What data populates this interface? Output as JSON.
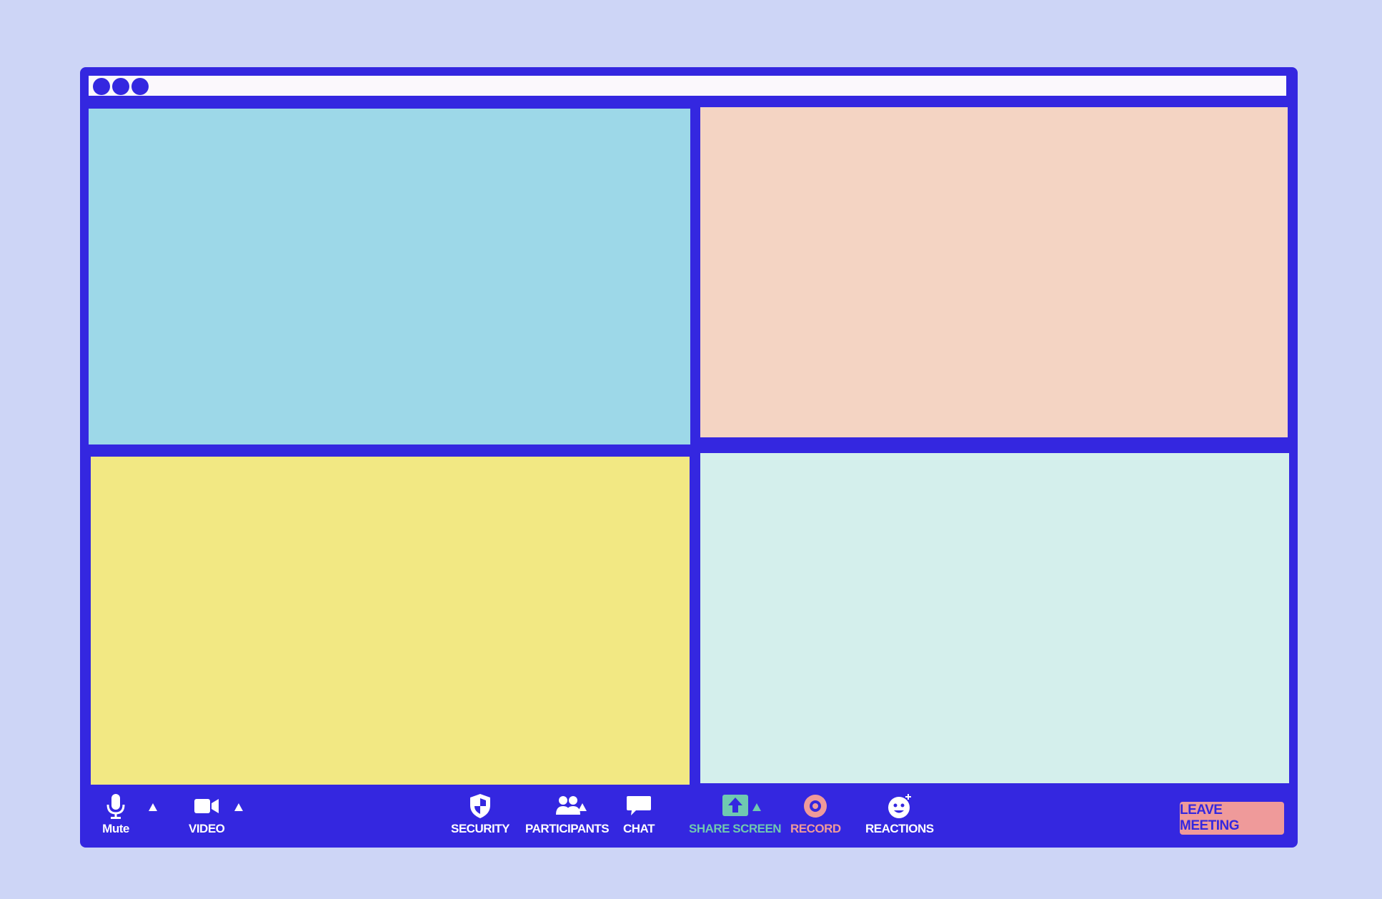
{
  "window": {
    "frame_color": "#3427e0",
    "titlebar_color": "#fbf8fc",
    "titlebar_dots": 3
  },
  "video_tiles": [
    {
      "color": "#9dd8e8"
    },
    {
      "color": "#f4d4c3"
    },
    {
      "color": "#f2e883"
    },
    {
      "color": "#d4efec"
    }
  ],
  "toolbar": {
    "mute": {
      "label": "Mute",
      "icon": "microphone-icon"
    },
    "video": {
      "label": "VIDEO",
      "icon": "video-camera-icon"
    },
    "security": {
      "label": "SECURITY",
      "icon": "shield-icon"
    },
    "participants": {
      "label": "PARTICIPANTS",
      "icon": "people-icon"
    },
    "chat": {
      "label": "CHAT",
      "icon": "chat-bubble-icon"
    },
    "share_screen": {
      "label": "SHARE SCREEN",
      "icon": "share-arrow-icon",
      "color": "#6fc9b0"
    },
    "record": {
      "label": "RECORD",
      "icon": "record-icon",
      "color": "#ef9a9a"
    },
    "reactions": {
      "label": "REACTIONS",
      "icon": "smiley-icon"
    },
    "leave": {
      "label": "LEAVE MEETING",
      "bg_color": "#ef9a9a"
    }
  }
}
